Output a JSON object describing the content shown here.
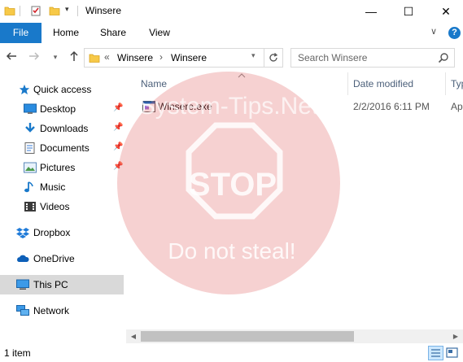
{
  "window": {
    "title": "Winsere",
    "minimize_glyph": "—",
    "maximize_glyph": "☐",
    "close_glyph": "✕"
  },
  "ribbon": {
    "tabs": [
      {
        "label": "File"
      },
      {
        "label": "Home"
      },
      {
        "label": "Share"
      },
      {
        "label": "View"
      }
    ]
  },
  "address": {
    "prefix": "«",
    "crumbs": [
      "Winsere",
      "Winsere"
    ],
    "separator": "›"
  },
  "search": {
    "placeholder": "Search Winsere"
  },
  "nav": {
    "quick_access": "Quick access",
    "items": [
      {
        "label": "Desktop",
        "icon": "desktop-icon",
        "pinned": true
      },
      {
        "label": "Downloads",
        "icon": "download-icon",
        "pinned": true
      },
      {
        "label": "Documents",
        "icon": "documents-icon",
        "pinned": true
      },
      {
        "label": "Pictures",
        "icon": "pictures-icon",
        "pinned": true
      },
      {
        "label": "Music",
        "icon": "music-icon",
        "pinned": false
      },
      {
        "label": "Videos",
        "icon": "videos-icon",
        "pinned": false
      }
    ],
    "dropbox": "Dropbox",
    "onedrive": "OneDrive",
    "this_pc": "This PC",
    "network": "Network"
  },
  "columns": {
    "name": "Name",
    "date_modified": "Date modified",
    "type": "Typ"
  },
  "files": [
    {
      "name": "Winsere.exe",
      "date": "2/2/2016 6:11 PM",
      "type": "Ap"
    }
  ],
  "status": {
    "item_count": "1 item"
  },
  "watermark": {
    "site": "System-Tips.Net",
    "sign": "STOP",
    "notice": "Do not steal!"
  },
  "colors": {
    "accent": "#1979ca",
    "selected": "#cce8ff",
    "watermark": "#e05a5a"
  }
}
